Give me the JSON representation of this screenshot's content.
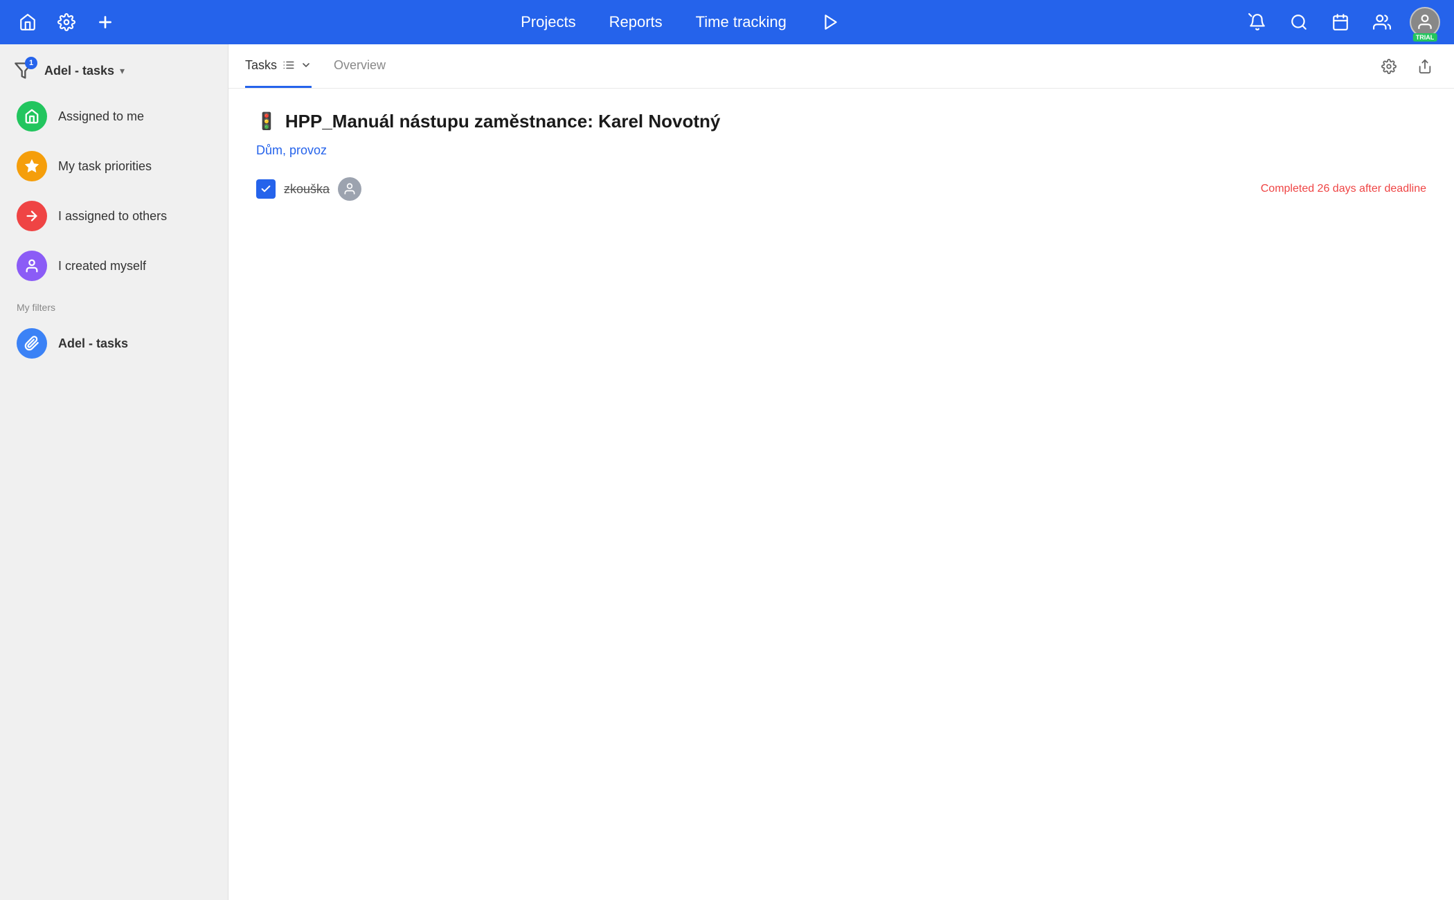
{
  "topnav": {
    "projects_label": "Projects",
    "reports_label": "Reports",
    "timetracking_label": "Time tracking",
    "trial_label": "TRIAL"
  },
  "sidebar": {
    "title": "Adel - tasks",
    "filter_badge_count": "1",
    "items": [
      {
        "id": "assigned-to-me",
        "label": "Assigned to me",
        "icon_type": "home",
        "icon_class": "icon-green"
      },
      {
        "id": "my-task-priorities",
        "label": "My task priorities",
        "icon_type": "star",
        "icon_class": "icon-orange"
      },
      {
        "id": "i-assigned-to-others",
        "label": "I assigned to others",
        "icon_type": "arrow",
        "icon_class": "icon-red"
      },
      {
        "id": "i-created-myself",
        "label": "I created myself",
        "icon_type": "person",
        "icon_class": "icon-purple"
      }
    ],
    "my_filters_label": "My filters",
    "filter_items": [
      {
        "id": "adel-tasks-filter",
        "label": "Adel - tasks",
        "icon_class": "icon-blue",
        "icon_type": "clip"
      }
    ]
  },
  "content": {
    "tabs": [
      {
        "id": "tasks",
        "label": "Tasks",
        "active": true
      },
      {
        "id": "overview",
        "label": "Overview",
        "active": false
      }
    ],
    "task_section": {
      "title": "🚦 HPP_Manuál nástupu zaměstnance: Karel Novotný",
      "project_name": "Dům, provoz",
      "task_name": "zkouška",
      "task_status": "Completed 26 days after deadline"
    }
  }
}
